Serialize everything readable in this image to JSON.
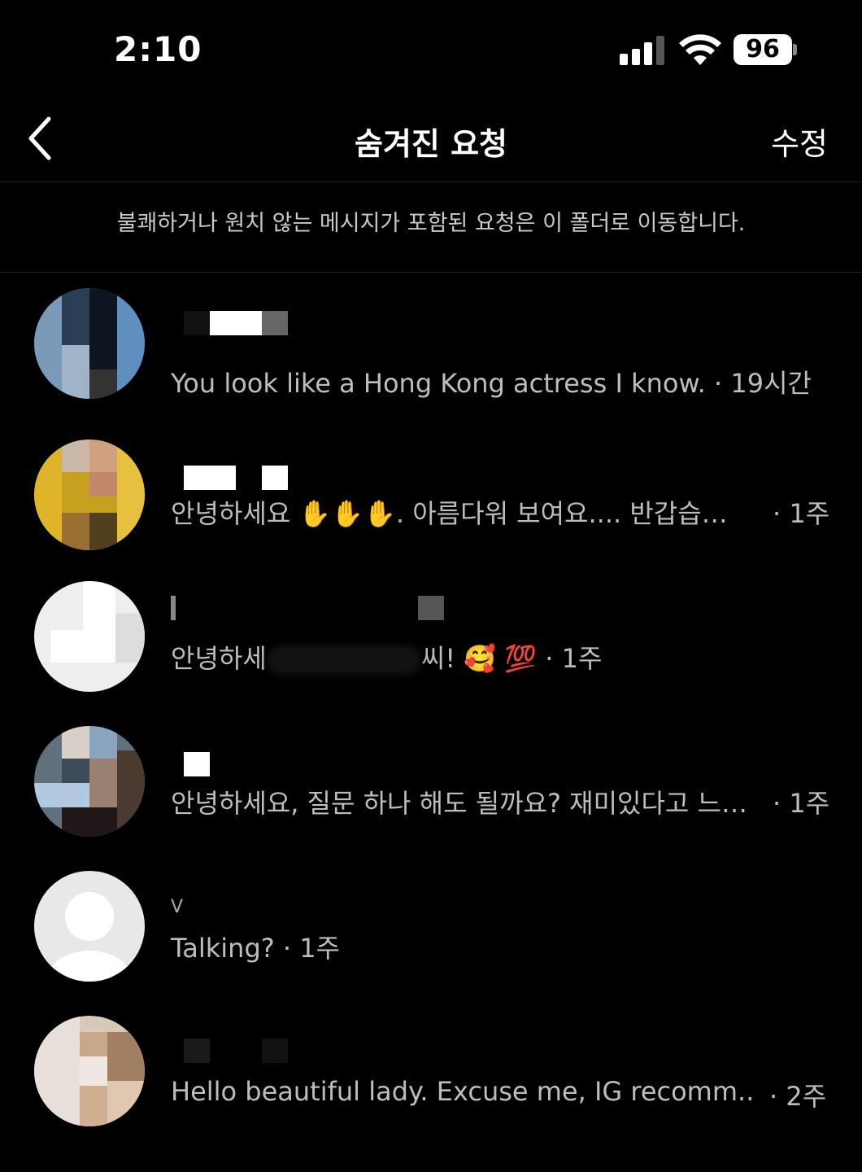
{
  "status": {
    "time": "2:10",
    "battery": "96"
  },
  "header": {
    "title": "숨겨진 요청",
    "edit": "수정"
  },
  "notice": "불쾌하거나 원치 않는 메시지가 포함된 요청은 이 폴더로 이동합니다.",
  "requests": [
    {
      "message": "You look like a Hong Kong actress I know.",
      "time": "· 19시간"
    },
    {
      "message": "안녕하세요 ✋✋✋. 아름다워 보여요.... 반갑습…",
      "time": "· 1주"
    },
    {
      "message_start": "안녕하세",
      "message_end": "씨! 🥰 💯",
      "time": "· 1주"
    },
    {
      "message": "안녕하세요, 질문 하나 해도 될까요? 재미있다고 느…",
      "time": "· 1주"
    },
    {
      "name_fragment": "V",
      "message": "Talking?",
      "time": "· 1주"
    },
    {
      "message": "Hello beautiful lady. Excuse me, IG recomm...",
      "time": "· 2주"
    }
  ],
  "icons": {
    "back": "chevron-left-icon",
    "signal": "cellular-signal-icon",
    "wifi": "wifi-icon",
    "battery": "battery-icon",
    "default_avatar": "person-silhouette-icon"
  }
}
